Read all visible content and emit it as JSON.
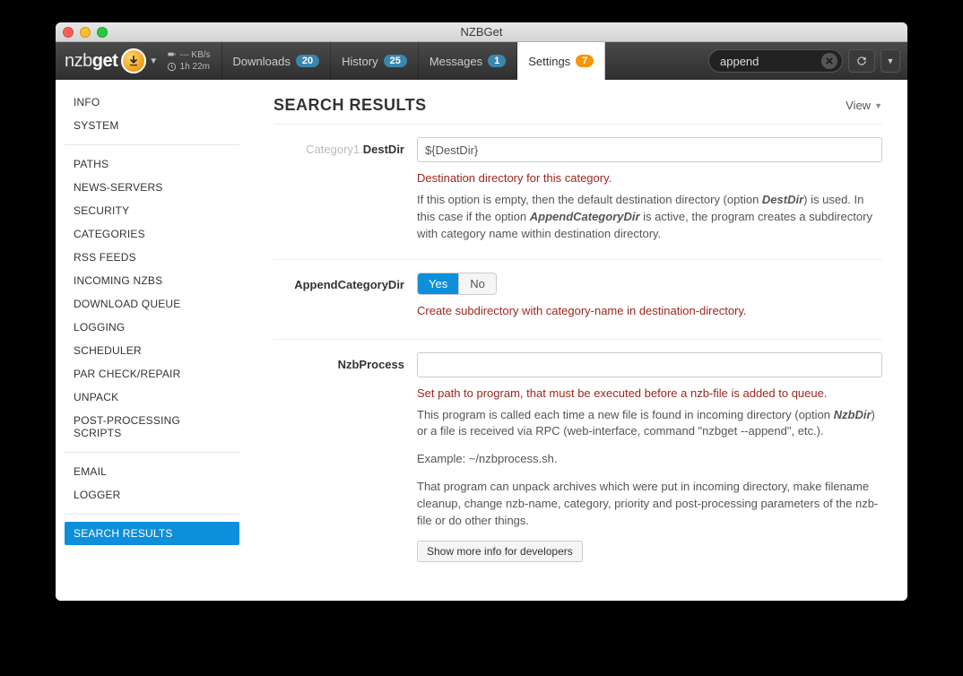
{
  "window": {
    "title": "NZBGet"
  },
  "brand": {
    "name_part1": "nzb",
    "name_part2": "get"
  },
  "status": {
    "speed": "--- KB/s",
    "time": "1h 22m"
  },
  "tabs": [
    {
      "label": "Downloads",
      "badge": "20",
      "badge_style": "blue"
    },
    {
      "label": "History",
      "badge": "25",
      "badge_style": "blue"
    },
    {
      "label": "Messages",
      "badge": "1",
      "badge_style": "blue"
    },
    {
      "label": "Settings",
      "badge": "7",
      "badge_style": "orange",
      "active": true
    }
  ],
  "search": {
    "value": "append"
  },
  "sidebar": {
    "groups": [
      [
        "INFO",
        "SYSTEM"
      ],
      [
        "PATHS",
        "NEWS-SERVERS",
        "SECURITY",
        "CATEGORIES",
        "RSS FEEDS",
        "INCOMING NZBS",
        "DOWNLOAD QUEUE",
        "LOGGING",
        "SCHEDULER",
        "PAR CHECK/REPAIR",
        "UNPACK",
        "POST-PROCESSING SCRIPTS"
      ],
      [
        "EMAIL",
        "LOGGER"
      ],
      [
        "SEARCH RESULTS"
      ]
    ],
    "active": "SEARCH RESULTS"
  },
  "main": {
    "title": "SEARCH RESULTS",
    "view_label": "View",
    "fields": {
      "destdir": {
        "label_prefix": "Category1.",
        "label": "DestDir",
        "value": "${DestDir}",
        "help_primary": "Destination directory for this category.",
        "help_body_html": "If this option is empty, then the default destination directory (option <em>DestDir</em>) is used. In this case if the option <em>AppendCategoryDir</em> is active, the program creates a subdirectory with category name within destination directory."
      },
      "appendcategorydir": {
        "label": "AppendCategoryDir",
        "yes": "Yes",
        "no": "No",
        "selected": "yes",
        "help_primary": "Create subdirectory with category-name in destination-directory."
      },
      "nzbprocess": {
        "label": "NzbProcess",
        "value": "",
        "help_primary": "Set path to program, that must be executed before a nzb-file is added to queue.",
        "help_body_html": "<p>This program is called each time a new file is found in incoming directory (option <em>NzbDir</em>) or a file is received via RPC (web-interface, command \"nzbget --append\", etc.).</p><p>Example: ~/nzbprocess.sh.</p><p>That program can unpack archives which were put in incoming directory, make filename cleanup, change nzb-name, category, priority and post-processing parameters of the nzb-file or do other things.</p>",
        "show_more": "Show more info for developers"
      }
    }
  }
}
